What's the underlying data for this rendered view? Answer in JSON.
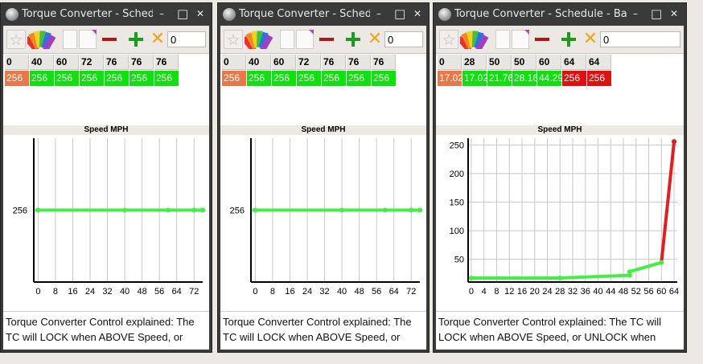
{
  "windows": [
    {
      "title": "Torque Converter - Sched...",
      "toolbar_value": "0",
      "headers": [
        "0",
        "40",
        "60",
        "72",
        "76",
        "76",
        "76"
      ],
      "values": [
        "256",
        "256",
        "256",
        "256",
        "256",
        "256",
        "256"
      ],
      "value_colors": [
        "#e8784a",
        "#10e010",
        "#10e010",
        "#10e010",
        "#10e010",
        "#10e010",
        "#10e010"
      ],
      "xlabel": "Speed MPH",
      "description": "Torque Converter Control explained: The TC will LOCK when ABOVE Speed, or",
      "chart_data": {
        "type": "line",
        "x": [
          0,
          40,
          60,
          72,
          76,
          76,
          76
        ],
        "y": [
          256,
          256,
          256,
          256,
          256,
          256,
          256
        ],
        "xlim": [
          -2,
          76
        ],
        "x_ticks": [
          "0",
          "8",
          "16",
          "24",
          "32",
          "40",
          "48",
          "56",
          "64",
          "72"
        ],
        "y_ticks": [
          "256"
        ],
        "color": "#44ee44",
        "grid": "vertical"
      }
    },
    {
      "title": "Torque Converter - Sched...",
      "toolbar_value": "0",
      "headers": [
        "0",
        "40",
        "60",
        "72",
        "76",
        "76",
        "76"
      ],
      "values": [
        "256",
        "256",
        "256",
        "256",
        "256",
        "256",
        "256"
      ],
      "value_colors": [
        "#e8784a",
        "#10e010",
        "#10e010",
        "#10e010",
        "#10e010",
        "#10e010",
        "#10e010"
      ],
      "xlabel": "Speed MPH",
      "description": "Torque Converter Control explained: The TC will LOCK when ABOVE Speed, or",
      "chart_data": {
        "type": "line",
        "x": [
          0,
          40,
          60,
          72,
          76,
          76,
          76
        ],
        "y": [
          256,
          256,
          256,
          256,
          256,
          256,
          256
        ],
        "xlim": [
          -2,
          76
        ],
        "x_ticks": [
          "0",
          "8",
          "16",
          "24",
          "32",
          "40",
          "48",
          "56",
          "64",
          "72"
        ],
        "y_ticks": [
          "256"
        ],
        "color": "#44ee44",
        "grid": "vertical"
      }
    },
    {
      "title": "Torque Converter - Schedule - Bas...",
      "toolbar_value": "0",
      "headers": [
        "0",
        "28",
        "50",
        "50",
        "60",
        "64",
        "64"
      ],
      "values": [
        "17.02",
        "17.02",
        "21.76",
        "28.16",
        "44.29",
        "256",
        "256"
      ],
      "value_colors": [
        "#e8784a",
        "#10e010",
        "#10e010",
        "#10e010",
        "#10e010",
        "#e01010",
        "#e01010"
      ],
      "xlabel": "Speed MPH",
      "description": "Torque Converter Control explained: The TC will LOCK when ABOVE Speed, or UNLOCK when",
      "chart_data": {
        "type": "line",
        "x": [
          0,
          28,
          50,
          50,
          60,
          64,
          64
        ],
        "y": [
          17.02,
          17.02,
          21.76,
          28.16,
          44.29,
          256,
          256
        ],
        "xlim": [
          -1,
          65
        ],
        "ylim": [
          10,
          262
        ],
        "x_ticks": [
          "0",
          "4",
          "8",
          "12",
          "16",
          "20",
          "24",
          "28",
          "32",
          "36",
          "40",
          "44",
          "48",
          "52",
          "56",
          "60",
          "64"
        ],
        "y_ticks": [
          "50",
          "100",
          "150",
          "200",
          "250"
        ],
        "color": "#44ee44",
        "high_color": "#e02020",
        "grid": "both"
      }
    }
  ]
}
